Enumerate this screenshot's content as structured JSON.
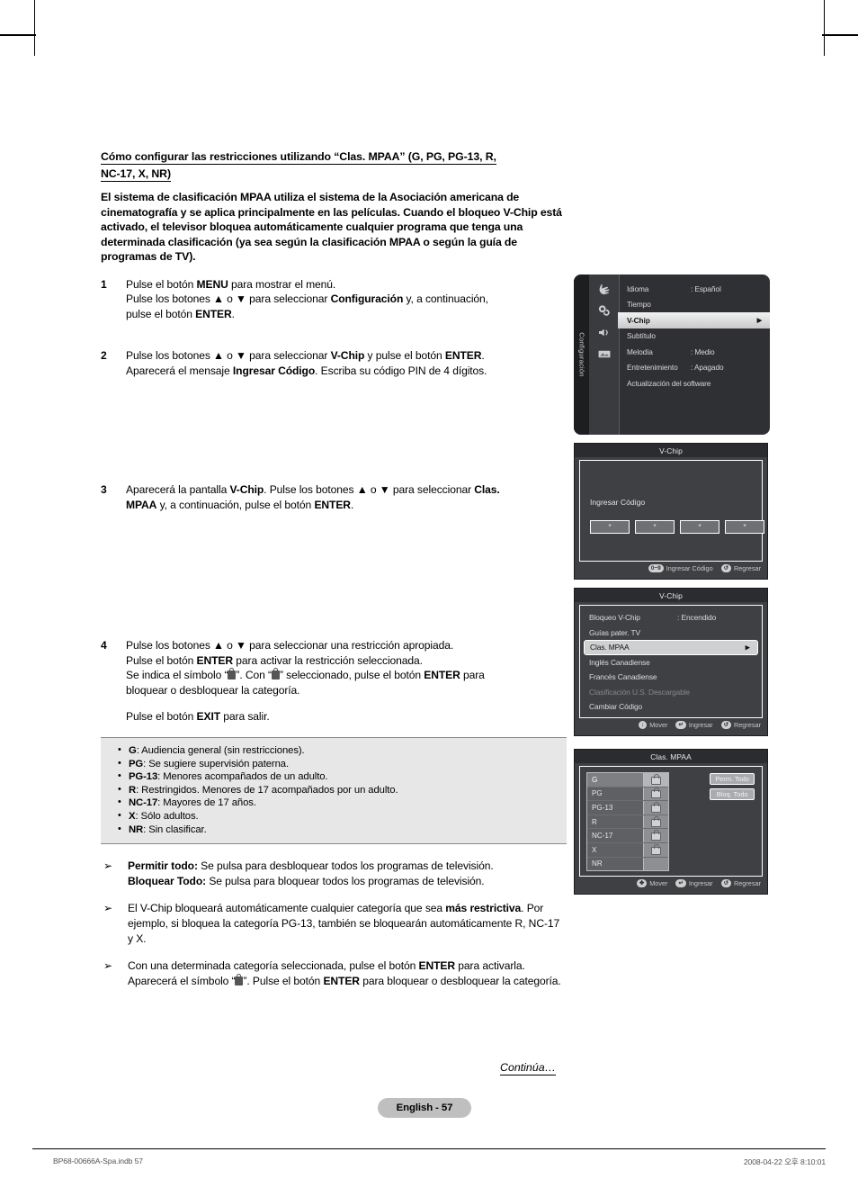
{
  "document": {
    "heading": "Cómo configurar las restricciones utilizando “Clas. MPAA” (G, PG, PG-13, R, NC-17, X, NR)",
    "intro": "El sistema de clasificación MPAA utiliza el sistema de la Asociación americana de cinematografía y se aplica principalmente en las películas. Cuando el bloqueo V-Chip está activado, el televisor bloquea automáticamente cualquier programa que tenga una determinada clasificación (ya sea según la clasificación MPAA o según la guía de programas de TV).",
    "steps": [
      {
        "num": "1",
        "html": "Pulse el botón <b>MENU</b> para mostrar el menú.<br>Pulse los botones ▲ o ▼ para seleccionar <b>Configuración</b> y, a continuación,<br>pulse el botón <b>ENTER</b>."
      },
      {
        "num": "2",
        "html": "Pulse los botones ▲ o ▼ para seleccionar <b>V-Chip</b> y pulse el botón <b>ENTER</b>.<br>Aparecerá el mensaje <b>Ingresar Código</b>. Escriba su código PIN de 4 dígitos."
      },
      {
        "num": "3",
        "html": "Aparecerá la pantalla  <b>V-Chip</b>. Pulse los botones ▲ o ▼ para seleccionar <b>Clas.<br>MPAA</b> y, a continuación, pulse el botón <b>ENTER</b>."
      },
      {
        "num": "4",
        "html": "Pulse los botones ▲ o ▼ para seleccionar una restricción apropiada.<br>Pulse el botón <b>ENTER</b> para activar la restricción seleccionada.<br>Se indica el símbolo “<span class=\"lockglyph\"></span>”. Con “<span class=\"lockglyph\"></span>” seleccionado, pulse el botón <b>ENTER</b> para<br>bloquear o desbloquear la categoría."
      }
    ],
    "exit_line": "Pulse el botón <b>EXIT</b> para salir.",
    "ratings_box": [
      {
        "code": "G",
        "desc": ": Audiencia general (sin restricciones)."
      },
      {
        "code": "PG",
        "desc": ": Se sugiere supervisión paterna."
      },
      {
        "code": "PG-13",
        "desc": ": Menores acompañados de un adulto."
      },
      {
        "code": "R",
        "desc": ": Restringidos. Menores de 17 acompañados por un adulto."
      },
      {
        "code": "NC-17",
        "desc": ": Mayores de 17 años."
      },
      {
        "code": "X",
        "desc": ": Sólo adultos."
      },
      {
        "code": "NR",
        "desc": ": Sin clasificar."
      }
    ],
    "notes": [
      "<b>Permitir todo:</b> Se pulsa para desbloquear todos los programas de televisión.<br><b>Bloquear Todo:</b> Se pulsa para bloquear todos los programas de televisión.",
      "El V-Chip bloqueará automáticamente cualquier categoría que sea <b>más restrictiva</b>. Por ejemplo, si bloquea la categoría PG-13, también se bloquearán automáticamente R, NC-17 y X.",
      "Con una determinada categoría seleccionada, pulse el botón <b>ENTER</b> para activarla. Aparecerá el símbolo “<span class=\"lockglyph\"></span>”. Pulse el botón <b>ENTER</b> para bloquear o desbloquear la categoría."
    ],
    "continua": "Continúa…",
    "page_badge": "English - 57",
    "footer_left": "BP68-00666A-Spa.indb   57",
    "footer_right": "2008-04-22   오후 8:10:01"
  },
  "osd_setup_menu": {
    "tab_label": "Configuración",
    "icons": [
      "hand-pointer-icon",
      "gear-icon",
      "speaker-icon",
      "screen-card-icon"
    ],
    "rows": [
      {
        "label": "Idioma",
        "value": ": Español",
        "selected": false
      },
      {
        "label": "Tiempo",
        "value": "",
        "selected": false
      },
      {
        "label": "V-Chip",
        "value": "",
        "selected": true
      },
      {
        "label": "Subtítulo",
        "value": "",
        "selected": false
      },
      {
        "label": "Melodía",
        "value": ": Medio",
        "selected": false
      },
      {
        "label": "Entretenimiento",
        "value": ": Apagado",
        "selected": false
      },
      {
        "label": "Actualización del software",
        "value": "",
        "selected": false
      }
    ]
  },
  "osd_pin_screen": {
    "title": "V-Chip",
    "label": "Ingresar Código",
    "cells": [
      "*",
      "*",
      "*",
      "*"
    ],
    "footer": [
      {
        "key": "0~9",
        "text": "Ingresar Código"
      },
      {
        "key": "↺",
        "text": "Regresar"
      }
    ]
  },
  "osd_vchip_menu": {
    "title": "V-Chip",
    "rows": [
      {
        "label": "Bloqueo V-Chip",
        "value": ": Encendido",
        "selected": false,
        "dim": false
      },
      {
        "label": "Guías pater. TV",
        "value": "",
        "selected": false,
        "dim": false
      },
      {
        "label": "Clas. MPAA",
        "value": "",
        "selected": true,
        "dim": false
      },
      {
        "label": "Inglés Canadiense",
        "value": "",
        "selected": false,
        "dim": false
      },
      {
        "label": "Francés Canadiense",
        "value": "",
        "selected": false,
        "dim": false
      },
      {
        "label": "Clasificación U.S. Descargable",
        "value": "",
        "selected": false,
        "dim": true
      },
      {
        "label": "Cambiar Código",
        "value": "",
        "selected": false,
        "dim": false
      }
    ],
    "footer": [
      {
        "key": "↕",
        "text": "Mover"
      },
      {
        "key": "↵",
        "text": "Ingresar"
      },
      {
        "key": "↺",
        "text": "Regresar"
      }
    ]
  },
  "osd_mpaa_screen": {
    "title": "Clas. MPAA",
    "rows": [
      {
        "label": "G",
        "locked": true,
        "highlighted": true
      },
      {
        "label": "PG",
        "locked": true,
        "highlighted": false
      },
      {
        "label": "PG-13",
        "locked": true,
        "highlighted": false
      },
      {
        "label": "R",
        "locked": true,
        "highlighted": false
      },
      {
        "label": "NC-17",
        "locked": true,
        "highlighted": false
      },
      {
        "label": "X",
        "locked": true,
        "highlighted": false
      },
      {
        "label": "NR",
        "locked": false,
        "highlighted": false
      }
    ],
    "buttons": [
      "Perm. Todo",
      "Bloq. Todo"
    ],
    "footer": [
      {
        "key": "✥",
        "text": "Mover"
      },
      {
        "key": "↵",
        "text": "Ingresar"
      },
      {
        "key": "↺",
        "text": "Regresar"
      }
    ]
  },
  "colors": {
    "page_bg": "#ffffff",
    "osd_dark": "#3f4043",
    "osd_title_bar": "#2b2c2f",
    "osd_selected": "#cfd0d2",
    "gray_box": "#e7e7e7",
    "badge": "#bfbfbf"
  }
}
